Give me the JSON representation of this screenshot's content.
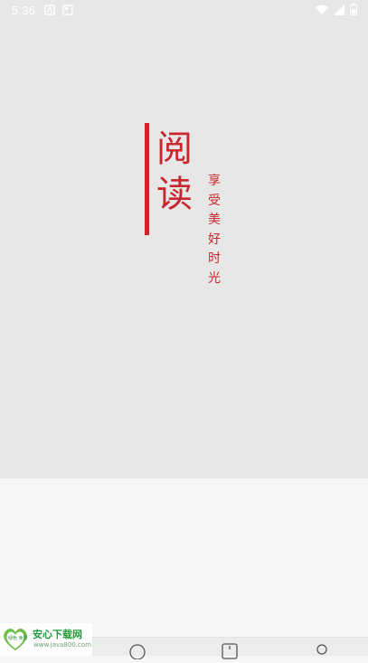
{
  "status_bar": {
    "time": "5:36",
    "left_icons": [
      "notification-a-icon",
      "notification-gallery-icon"
    ],
    "right_icons": [
      "wifi-icon",
      "signal-icon",
      "battery-icon"
    ]
  },
  "splash": {
    "title": "阅读",
    "tagline": "享受美好时光",
    "accent_color": "#c9262d",
    "background_color": "#e7e7e7"
  },
  "bottom_nav": {
    "icons": [
      "home-icon",
      "discover-icon",
      "bookshelf-icon",
      "profile-icon"
    ]
  },
  "watermark": {
    "title": "安心下载网",
    "url": "www.java800.com",
    "badge": "绿色 免费"
  }
}
